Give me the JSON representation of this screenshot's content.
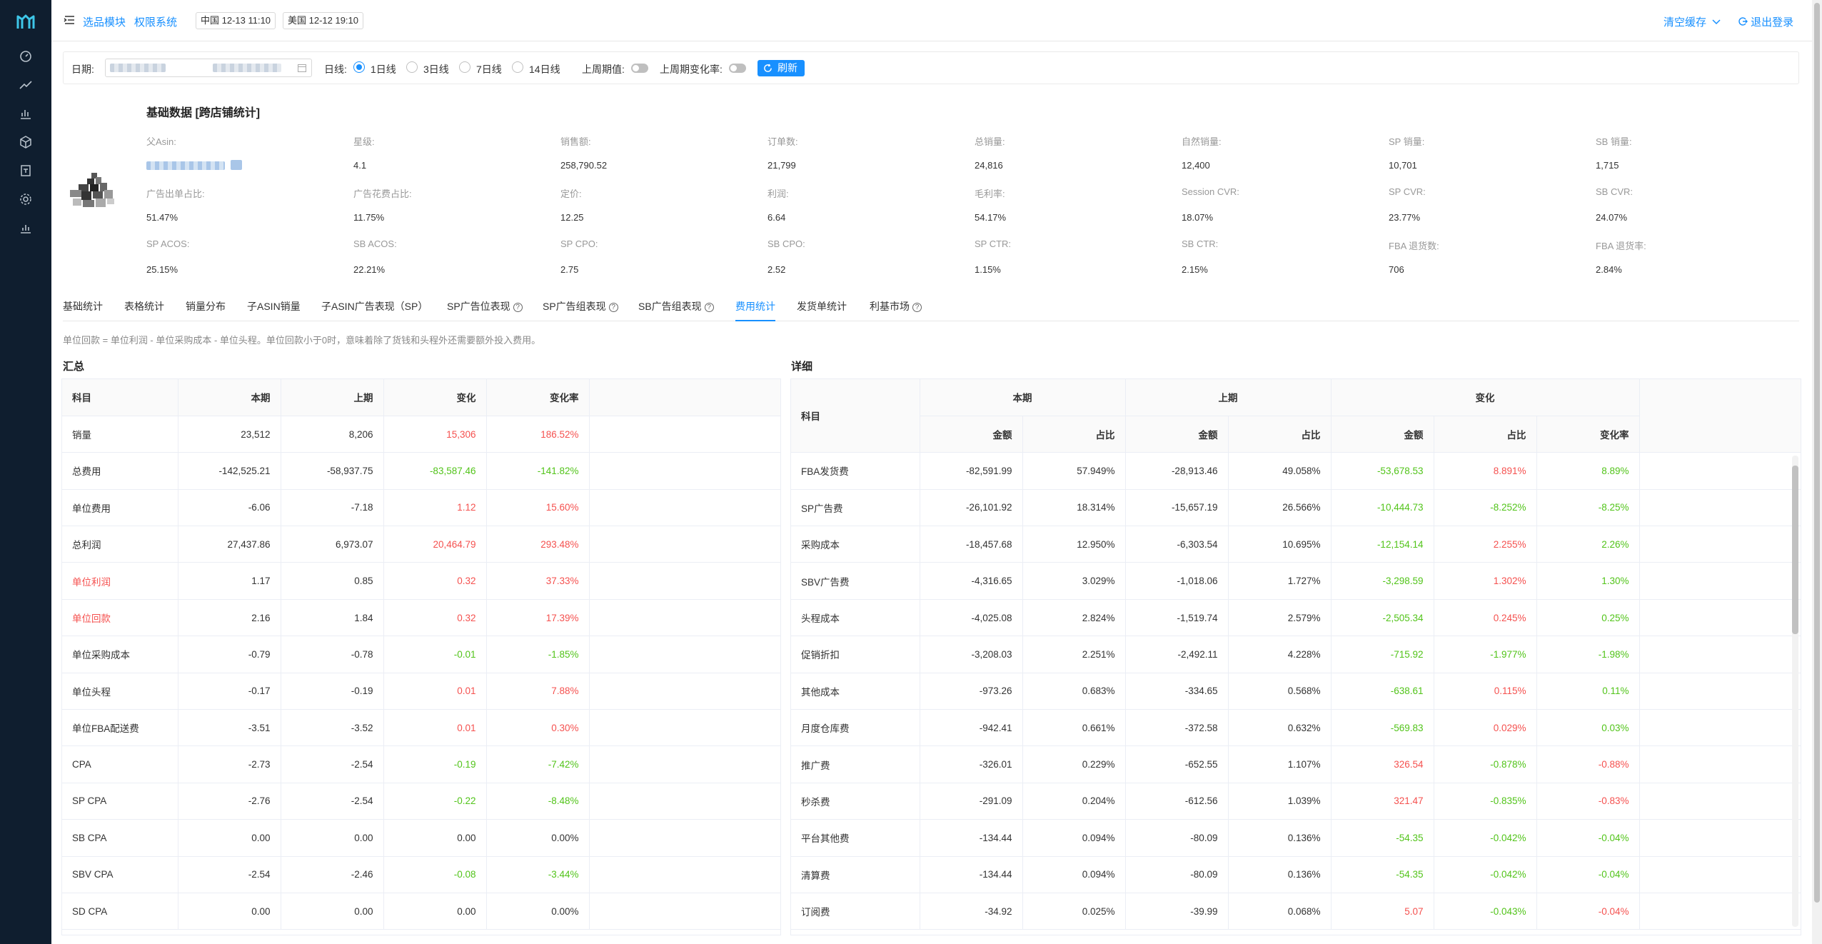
{
  "nav": {
    "icons": [
      "logo-icon",
      "dashboard-icon",
      "trend-icon",
      "bar-chart-icon",
      "cube-icon",
      "calendar-icon",
      "settings-icon",
      "report-icon"
    ]
  },
  "header": {
    "links": [
      "选品模块",
      "权限系统"
    ],
    "time_cn": "中国 12-13 11:10",
    "time_us": "美国 12-12 19:10",
    "clear_cache": "清空缓存",
    "logout": "退出登录"
  },
  "filter": {
    "date_label": "日期:",
    "line_label": "日线:",
    "options": [
      "1日线",
      "3日线",
      "7日线",
      "14日线"
    ],
    "selected": "1日线",
    "last_period_label": "上周期值:",
    "last_change_label": "上周期变化率:",
    "refresh": "刷新"
  },
  "product": {
    "title": "基础数据 [跨店铺统计]",
    "fields": [
      {
        "label": "父Asin:",
        "value": ""
      },
      {
        "label": "星级:",
        "value": "4.1"
      },
      {
        "label": "销售额:",
        "value": "258,790.52"
      },
      {
        "label": "订单数:",
        "value": "21,799"
      },
      {
        "label": "总销量:",
        "value": "24,816"
      },
      {
        "label": "自然销量:",
        "value": "12,400"
      },
      {
        "label": "SP 销量:",
        "value": "10,701"
      },
      {
        "label": "SB 销量:",
        "value": "1,715"
      },
      {
        "label": "广告出单占比:",
        "value": "51.47%"
      },
      {
        "label": "广告花费占比:",
        "value": "11.75%"
      },
      {
        "label": "定价:",
        "value": "12.25"
      },
      {
        "label": "利润:",
        "value": "6.64"
      },
      {
        "label": "毛利率:",
        "value": "54.17%"
      },
      {
        "label": "Session CVR:",
        "value": "18.07%"
      },
      {
        "label": "SP CVR:",
        "value": "23.77%"
      },
      {
        "label": "SB CVR:",
        "value": "24.07%"
      },
      {
        "label": "SP ACOS:",
        "value": "25.15%"
      },
      {
        "label": "SB ACOS:",
        "value": "22.21%"
      },
      {
        "label": "SP CPO:",
        "value": "2.75"
      },
      {
        "label": "SB CPO:",
        "value": "2.52"
      },
      {
        "label": "SP CTR:",
        "value": "1.15%"
      },
      {
        "label": "SB CTR:",
        "value": "2.15%"
      },
      {
        "label": "FBA 退货数:",
        "value": "706"
      },
      {
        "label": "FBA 退货率:",
        "value": "2.84%"
      }
    ]
  },
  "tabs": [
    {
      "label": "基础统计",
      "help": false
    },
    {
      "label": "表格统计",
      "help": false
    },
    {
      "label": "销量分布",
      "help": false
    },
    {
      "label": "子ASIN销量",
      "help": false
    },
    {
      "label": "子ASIN广告表现（SP）",
      "help": false
    },
    {
      "label": "SP广告位表现",
      "help": true
    },
    {
      "label": "SP广告组表现",
      "help": true
    },
    {
      "label": "SB广告组表现",
      "help": true
    },
    {
      "label": "费用统计",
      "help": false
    },
    {
      "label": "发货单统计",
      "help": false
    },
    {
      "label": "利基市场",
      "help": true
    }
  ],
  "active_tab": "费用统计",
  "note": "单位回款 = 单位利润 - 单位采购成本 - 单位头程。单位回款小于0时，意味着除了货钱和头程外还需要额外投入费用。",
  "summary": {
    "title": "汇总",
    "headers": [
      "科目",
      "本期",
      "上期",
      "变化",
      "变化率"
    ],
    "rows": [
      {
        "name": "销量",
        "cur": "23,512",
        "prev": "8,206",
        "chg": "15,306",
        "rate": "186.52%",
        "tone": "red",
        "hl": false
      },
      {
        "name": "总费用",
        "cur": "-142,525.21",
        "prev": "-58,937.75",
        "chg": "-83,587.46",
        "rate": "-141.82%",
        "tone": "green",
        "hl": false
      },
      {
        "name": "单位费用",
        "cur": "-6.06",
        "prev": "-7.18",
        "chg": "1.12",
        "rate": "15.60%",
        "tone": "red",
        "hl": false
      },
      {
        "name": "总利润",
        "cur": "27,437.86",
        "prev": "6,973.07",
        "chg": "20,464.79",
        "rate": "293.48%",
        "tone": "red",
        "hl": false
      },
      {
        "name": "单位利润",
        "cur": "1.17",
        "prev": "0.85",
        "chg": "0.32",
        "rate": "37.33%",
        "tone": "red",
        "hl": true
      },
      {
        "name": "单位回款",
        "cur": "2.16",
        "prev": "1.84",
        "chg": "0.32",
        "rate": "17.39%",
        "tone": "red",
        "hl": true
      },
      {
        "name": "单位采购成本",
        "cur": "-0.79",
        "prev": "-0.78",
        "chg": "-0.01",
        "rate": "-1.85%",
        "tone": "green",
        "hl": false
      },
      {
        "name": "单位头程",
        "cur": "-0.17",
        "prev": "-0.19",
        "chg": "0.01",
        "rate": "7.88%",
        "tone": "red",
        "hl": false
      },
      {
        "name": "单位FBA配送费",
        "cur": "-3.51",
        "prev": "-3.52",
        "chg": "0.01",
        "rate": "0.30%",
        "tone": "red",
        "hl": false
      },
      {
        "name": "CPA",
        "cur": "-2.73",
        "prev": "-2.54",
        "chg": "-0.19",
        "rate": "-7.42%",
        "tone": "green",
        "hl": false
      },
      {
        "name": "SP CPA",
        "cur": "-2.76",
        "prev": "-2.54",
        "chg": "-0.22",
        "rate": "-8.48%",
        "tone": "green",
        "hl": false
      },
      {
        "name": "SB CPA",
        "cur": "0.00",
        "prev": "0.00",
        "chg": "0.00",
        "rate": "0.00%",
        "tone": "zero",
        "hl": false
      },
      {
        "name": "SBV CPA",
        "cur": "-2.54",
        "prev": "-2.46",
        "chg": "-0.08",
        "rate": "-3.44%",
        "tone": "green",
        "hl": false
      },
      {
        "name": "SD CPA",
        "cur": "0.00",
        "prev": "0.00",
        "chg": "0.00",
        "rate": "0.00%",
        "tone": "zero",
        "hl": false
      }
    ]
  },
  "detail": {
    "title": "详细",
    "group_headers": [
      "科目",
      "本期",
      "上期",
      "变化"
    ],
    "sub_headers": [
      "金额",
      "占比",
      "金额",
      "占比",
      "金额",
      "占比",
      "变化率"
    ],
    "rows": [
      {
        "name": "FBA发货费",
        "cur_amt": "-82,591.99",
        "cur_pct": "57.949%",
        "prev_amt": "-28,913.46",
        "prev_pct": "49.058%",
        "chg_amt": "-53,678.53",
        "chg_pct": "8.891%",
        "rate": "8.89%",
        "amt_tone": "green",
        "pct_tone": "red",
        "rate_tone": "green"
      },
      {
        "name": "SP广告费",
        "cur_amt": "-26,101.92",
        "cur_pct": "18.314%",
        "prev_amt": "-15,657.19",
        "prev_pct": "26.566%",
        "chg_amt": "-10,444.73",
        "chg_pct": "-8.252%",
        "rate": "-8.25%",
        "amt_tone": "green",
        "pct_tone": "green",
        "rate_tone": "green"
      },
      {
        "name": "采购成本",
        "cur_amt": "-18,457.68",
        "cur_pct": "12.950%",
        "prev_amt": "-6,303.54",
        "prev_pct": "10.695%",
        "chg_amt": "-12,154.14",
        "chg_pct": "2.255%",
        "rate": "2.26%",
        "amt_tone": "green",
        "pct_tone": "red",
        "rate_tone": "green"
      },
      {
        "name": "SBV广告费",
        "cur_amt": "-4,316.65",
        "cur_pct": "3.029%",
        "prev_amt": "-1,018.06",
        "prev_pct": "1.727%",
        "chg_amt": "-3,298.59",
        "chg_pct": "1.302%",
        "rate": "1.30%",
        "amt_tone": "green",
        "pct_tone": "red",
        "rate_tone": "green"
      },
      {
        "name": "头程成本",
        "cur_amt": "-4,025.08",
        "cur_pct": "2.824%",
        "prev_amt": "-1,519.74",
        "prev_pct": "2.579%",
        "chg_amt": "-2,505.34",
        "chg_pct": "0.245%",
        "rate": "0.25%",
        "amt_tone": "green",
        "pct_tone": "red",
        "rate_tone": "green"
      },
      {
        "name": "促销折扣",
        "cur_amt": "-3,208.03",
        "cur_pct": "2.251%",
        "prev_amt": "-2,492.11",
        "prev_pct": "4.228%",
        "chg_amt": "-715.92",
        "chg_pct": "-1.977%",
        "rate": "-1.98%",
        "amt_tone": "green",
        "pct_tone": "green",
        "rate_tone": "green"
      },
      {
        "name": "其他成本",
        "cur_amt": "-973.26",
        "cur_pct": "0.683%",
        "prev_amt": "-334.65",
        "prev_pct": "0.568%",
        "chg_amt": "-638.61",
        "chg_pct": "0.115%",
        "rate": "0.11%",
        "amt_tone": "green",
        "pct_tone": "red",
        "rate_tone": "green"
      },
      {
        "name": "月度仓库费",
        "cur_amt": "-942.41",
        "cur_pct": "0.661%",
        "prev_amt": "-372.58",
        "prev_pct": "0.632%",
        "chg_amt": "-569.83",
        "chg_pct": "0.029%",
        "rate": "0.03%",
        "amt_tone": "green",
        "pct_tone": "red",
        "rate_tone": "green"
      },
      {
        "name": "推广费",
        "cur_amt": "-326.01",
        "cur_pct": "0.229%",
        "prev_amt": "-652.55",
        "prev_pct": "1.107%",
        "chg_amt": "326.54",
        "chg_pct": "-0.878%",
        "rate": "-0.88%",
        "amt_tone": "red",
        "pct_tone": "green",
        "rate_tone": "red"
      },
      {
        "name": "秒杀费",
        "cur_amt": "-291.09",
        "cur_pct": "0.204%",
        "prev_amt": "-612.56",
        "prev_pct": "1.039%",
        "chg_amt": "321.47",
        "chg_pct": "-0.835%",
        "rate": "-0.83%",
        "amt_tone": "red",
        "pct_tone": "green",
        "rate_tone": "red"
      },
      {
        "name": "平台其他费",
        "cur_amt": "-134.44",
        "cur_pct": "0.094%",
        "prev_amt": "-80.09",
        "prev_pct": "0.136%",
        "chg_amt": "-54.35",
        "chg_pct": "-0.042%",
        "rate": "-0.04%",
        "amt_tone": "green",
        "pct_tone": "green",
        "rate_tone": "green"
      },
      {
        "name": "清算费",
        "cur_amt": "-134.44",
        "cur_pct": "0.094%",
        "prev_amt": "-80.09",
        "prev_pct": "0.136%",
        "chg_amt": "-54.35",
        "chg_pct": "-0.042%",
        "rate": "-0.04%",
        "amt_tone": "green",
        "pct_tone": "green",
        "rate_tone": "green"
      },
      {
        "name": "订阅费",
        "cur_amt": "-34.92",
        "cur_pct": "0.025%",
        "prev_amt": "-39.99",
        "prev_pct": "0.068%",
        "chg_amt": "5.07",
        "chg_pct": "-0.043%",
        "rate": "-0.04%",
        "amt_tone": "red",
        "pct_tone": "green",
        "rate_tone": "red"
      }
    ]
  },
  "colors": {
    "nav_bg": "#0f1e2f",
    "accent": "#1890ff",
    "increase": "#f5514f",
    "decrease": "#52c41a"
  }
}
